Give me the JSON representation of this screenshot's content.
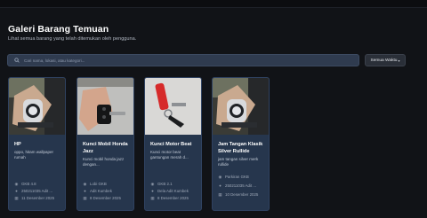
{
  "header": {
    "title": "Galeri Barang Temuan",
    "subtitle": "Lihat semua barang yang telah ditemukan oleh pengguna."
  },
  "search": {
    "placeholder": "Cari nama, lokasi, atau kategori...",
    "value": ""
  },
  "filter": {
    "selected": "Semua Waktu"
  },
  "cards": [
    {
      "title": "HP",
      "description": "oppo, hitam wallpaper rumah",
      "location": "GKB 4.8",
      "user": "250211035 Adit ...",
      "date": "11 Desember 2025"
    },
    {
      "title": "Kunci Mobil Honda Jazz",
      "description": "Kunci mobil honda jazz dengan...",
      "location": "Lobi GKB",
      "user": "Adit Kumbek",
      "date": "8 Desember 2025"
    },
    {
      "title": "Kunci Motor Beat",
      "description": "Kunci motor beat gantungan merah d...",
      "location": "GKB 2.1",
      "user": "Dela Adit Kumbek",
      "date": "8 Desember 2025"
    },
    {
      "title": "Jam Tangan Klasik Silver Rullide",
      "description": "jam tangan silver merk rullide",
      "location": "Parkiran GKB",
      "user": "250211035 Adit ...",
      "date": "10 Desember 2025"
    }
  ],
  "icons": {
    "search": "search-icon",
    "location": "map-pin-icon",
    "user": "user-icon",
    "date": "calendar-icon"
  },
  "colors": {
    "background": "#111317",
    "card": "#26364d",
    "search_bg": "#2f3b4f"
  }
}
